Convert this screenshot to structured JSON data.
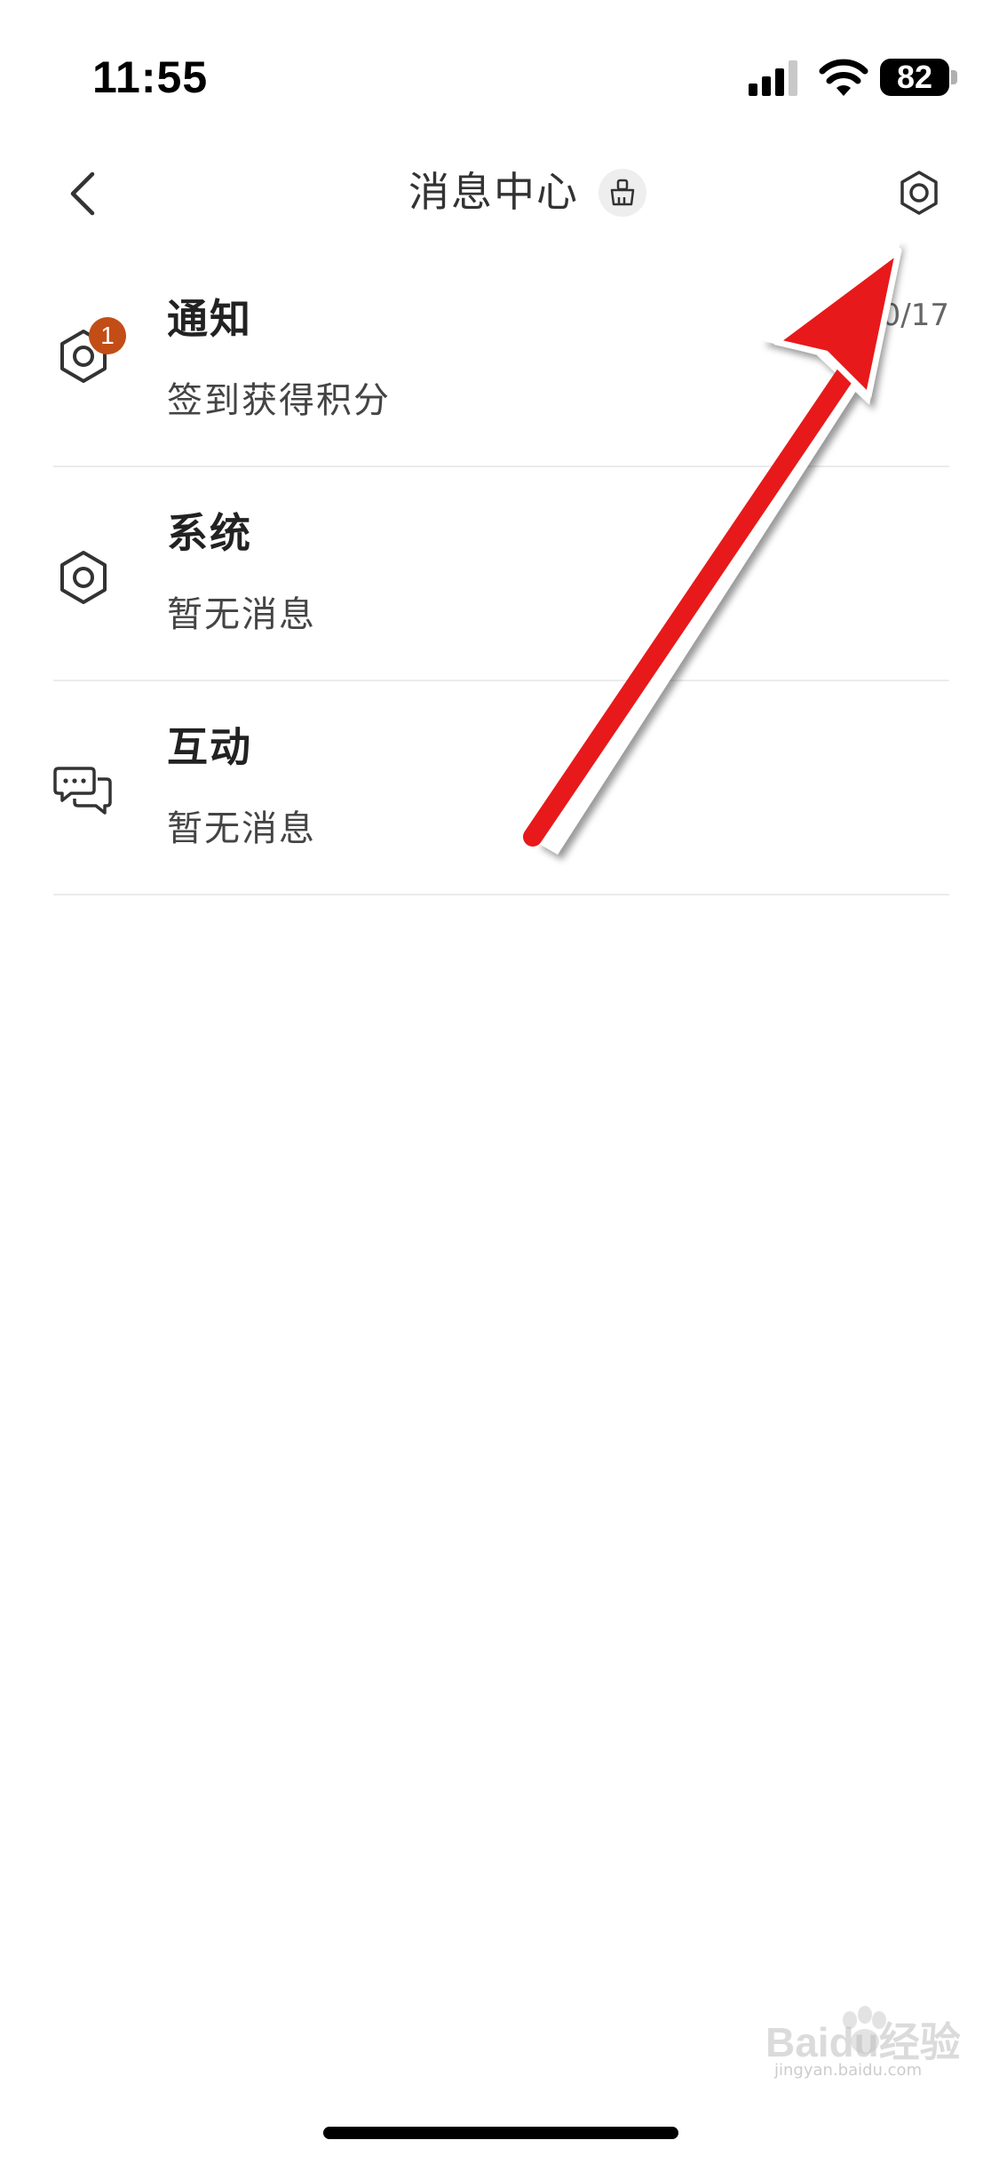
{
  "status_bar": {
    "time": "11:55",
    "battery_level": "82",
    "icons": [
      "cellular-signal-icon",
      "wifi-icon",
      "battery-icon"
    ]
  },
  "header": {
    "title": "消息中心",
    "back_icon": "chevron-left-icon",
    "clean_icon": "broom-clean-icon",
    "settings_icon": "gear-settings-icon"
  },
  "messages": [
    {
      "title": "通知",
      "subtitle": "签到获得积分",
      "date": "10/17",
      "badge": "1",
      "icon": "gear-icon"
    },
    {
      "title": "系统",
      "subtitle": "暂无消息",
      "icon": "gear-icon"
    },
    {
      "title": "互动",
      "subtitle": "暂无消息",
      "icon": "chat-bubbles-icon"
    }
  ],
  "annotation": {
    "arrow_color": "#e8191a"
  },
  "watermark": {
    "brand": "Baidu经验",
    "domain": "jingyan.baidu.com"
  },
  "colors": {
    "badge": "#c34d17",
    "text_primary": "#222222",
    "divider": "#ececec"
  }
}
